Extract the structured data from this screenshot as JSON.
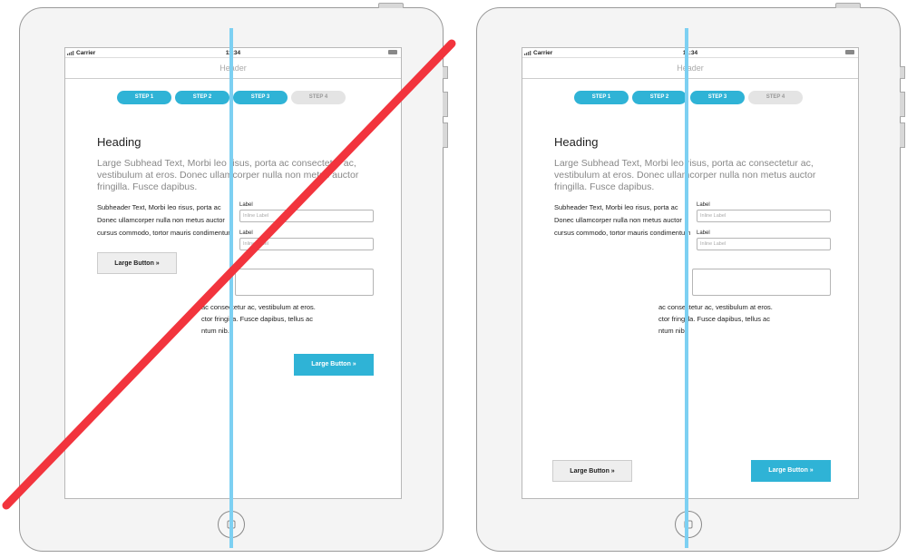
{
  "statusbar": {
    "carrier": "Carrier",
    "time": "11:34"
  },
  "header": {
    "title": "Header"
  },
  "steps": [
    {
      "label": "STEP 1",
      "state": "active"
    },
    {
      "label": "STEP 2",
      "state": "active"
    },
    {
      "label": "STEP 3",
      "state": "active"
    },
    {
      "label": "STEP 4",
      "state": "inactive"
    }
  ],
  "content": {
    "heading": "Heading",
    "subhead": "Large Subhead Text, Morbi leo risus, porta ac consectetur ac, vestibulum at eros. Donec ullamcorper nulla non metus auctor fringilla. Fusce dapibus.",
    "subheader_lines": [
      "Subheader Text, Morbi leo risus, porta ac",
      "Donec ullamcorper nulla non metus auctor",
      "cursus commodo, tortor mauris condimentum"
    ],
    "field1_label": "Label",
    "field1_placeholder": "Inline Label",
    "field2_label": "Label",
    "field2_placeholder": "Inline Label",
    "body_lines": [
      "ac consectetur ac, vestibulum at eros.",
      "ctor fringilla. Fusce dapibus, tellus ac",
      "ntum nib."
    ],
    "button_gray": "Large Button »",
    "button_blue": "Large Button »"
  },
  "colors": {
    "accent": "#2fb3d6",
    "guide": "#7dd0f2",
    "strike": "#f2343d"
  },
  "icons": {
    "home": "home-button-icon",
    "strike": "red-diagonal-strike"
  }
}
